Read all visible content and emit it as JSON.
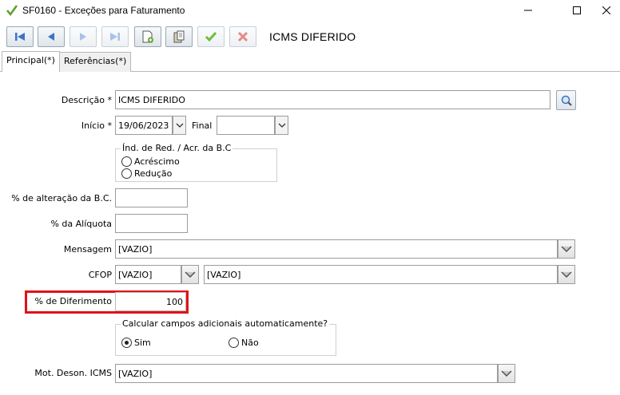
{
  "window": {
    "title": "SF0160 - Exceções para Faturamento"
  },
  "toolbar": {
    "record_title": "ICMS DIFERIDO"
  },
  "tabs": [
    {
      "label": "Principal(*)"
    },
    {
      "label": "Referências(*)"
    }
  ],
  "form": {
    "descricao": {
      "label": "Descrição *",
      "value": "ICMS DIFERIDO"
    },
    "inicio": {
      "label": "Início *",
      "value": "19/06/2023"
    },
    "final": {
      "label": "Final",
      "value": ""
    },
    "ind_red": {
      "title": "Índ. de Red. / Acr. da B.C",
      "options": [
        {
          "label": "Acréscimo",
          "checked": false
        },
        {
          "label": "Redução",
          "checked": false
        }
      ]
    },
    "perc_alteracao": {
      "label": "% de alteração da B.C.",
      "value": ""
    },
    "perc_aliquota": {
      "label": "% da Alíquota",
      "value": ""
    },
    "mensagem": {
      "label": "Mensagem",
      "value": "[VAZIO]"
    },
    "cfop": {
      "label": "CFOP",
      "code": "[VAZIO]",
      "description": "[VAZIO]"
    },
    "perc_diferimento": {
      "label": "% de Diferimento",
      "value": "100"
    },
    "calcular": {
      "title": "Calcular campos adicionais automaticamente?",
      "options": [
        {
          "label": "Sim",
          "checked": true
        },
        {
          "label": "Não",
          "checked": false
        }
      ]
    },
    "mot_deson": {
      "label": "Mot. Deson. ICMS",
      "value": "[VAZIO]"
    }
  },
  "colors": {
    "highlight": "#e0121a",
    "accent": "#3a73c9",
    "confirm": "#6bbf3a",
    "cancel": "#d9534f"
  }
}
